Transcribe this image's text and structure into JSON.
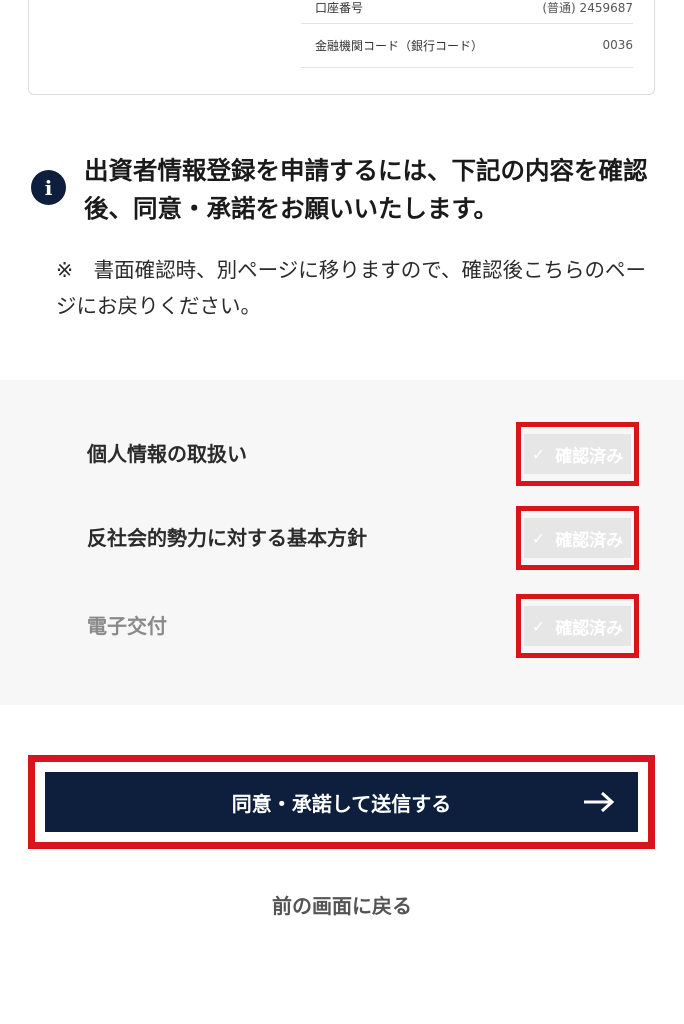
{
  "bank_info": {
    "rows": [
      {
        "label": "口座番号",
        "value": "(普通) 2459687"
      },
      {
        "label": "金融機関コード（銀行コード）",
        "value": "0036"
      }
    ]
  },
  "notice": {
    "icon": "info-icon",
    "title": "出資者情報登録を申請するには、下記の内容を確認後、同意・承諾をお願いいたします。",
    "note": "※　書面確認時、別ページに移りますので、確認後こちらのページにお戻りください。"
  },
  "documents": [
    {
      "label": "個人情報の取扱い",
      "status": "確認済み"
    },
    {
      "label": "反社会的勢力に対する基本方針",
      "status": "確認済み"
    },
    {
      "label": "電子交付",
      "status": "確認済み"
    }
  ],
  "actions": {
    "submit_label": "同意・承諾して送信する",
    "back_label": "前の画面に戻る"
  },
  "colors": {
    "primary": "#0d1f3c",
    "highlight": "#d9151c",
    "panel_bg": "#f7f7f7"
  }
}
